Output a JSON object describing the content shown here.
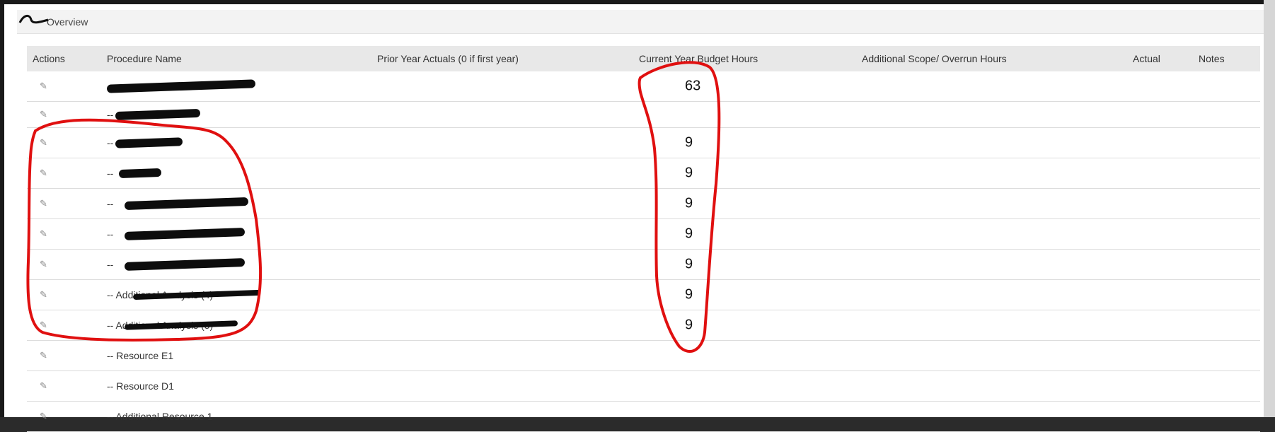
{
  "panel": {
    "title": "Overview"
  },
  "columns": {
    "actions": "Actions",
    "procedure_name": "Procedure Name",
    "prior_year": "Prior Year Actuals (0 if first year)",
    "current_budget": "Current Year Budget Hours",
    "additional_scope": "Additional Scope/ Overrun Hours",
    "actual": "Actual",
    "notes": "Notes"
  },
  "rows": [
    {
      "name": "",
      "budget": "63"
    },
    {
      "name": "-- ",
      "budget": ""
    },
    {
      "name": "-- ",
      "budget": "9"
    },
    {
      "name": "-- ",
      "budget": "9"
    },
    {
      "name": "-- ",
      "budget": "9"
    },
    {
      "name": "-- ",
      "budget": "9"
    },
    {
      "name": "-- ",
      "budget": "9"
    },
    {
      "name": "-- Additional Analysis (4)",
      "budget": "9"
    },
    {
      "name": "-- Additional Analysis (5)",
      "budget": "9"
    },
    {
      "name": "-- Resource E1",
      "budget": ""
    },
    {
      "name": "-- Resource D1",
      "budget": ""
    },
    {
      "name": "-- Additional Resource 1",
      "budget": ""
    }
  ],
  "icons": {
    "edit": "pencil-icon"
  },
  "colors": {
    "annotation": "#e01010",
    "header_bg": "#e8e8e8"
  }
}
